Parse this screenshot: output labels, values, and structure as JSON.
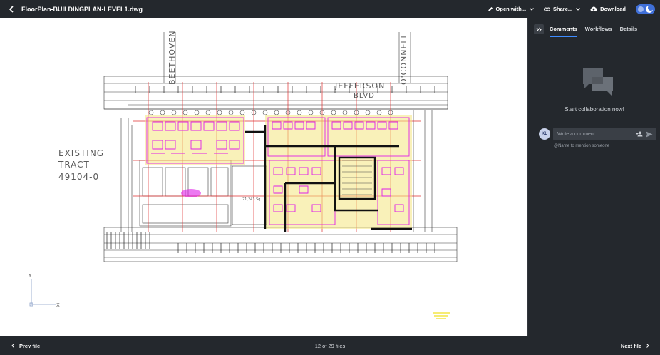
{
  "header": {
    "file_title": "FloorPlan-BUILDINGPLAN-LEVEL1.dwg",
    "open_with_label": "Open with...",
    "share_label": "Share...",
    "download_label": "Download"
  },
  "drawing": {
    "labels": {
      "beethoven": "BEETHOVEN",
      "oconnell": "O'CONNELL",
      "jefferson": "JEFFERSON",
      "blvd": "BLVD",
      "existing": "EXISTING",
      "tract": "TRACT",
      "tract_no": "49104-0",
      "area": "21,243 Sq",
      "axis_y": "Y",
      "axis_x": "X"
    }
  },
  "panel": {
    "tabs": [
      {
        "label": "Comments"
      },
      {
        "label": "Workflows"
      },
      {
        "label": "Details"
      }
    ],
    "empty_text": "Start collaboration now!",
    "avatar_initials": "KL",
    "comment_placeholder": "Write a comment...",
    "mention_hint": "@Name to mention someone"
  },
  "footer": {
    "prev_label": "Prev file",
    "counter_text": "12 of 29 files",
    "next_label": "Next file"
  },
  "colors": {
    "chrome_bg": "#24282d",
    "accent": "#3f8cff",
    "toggle": "#3f6fd8",
    "cad_magenta": "#e020e8",
    "cad_yellow": "#f0e020",
    "cad_red": "#e03030"
  }
}
